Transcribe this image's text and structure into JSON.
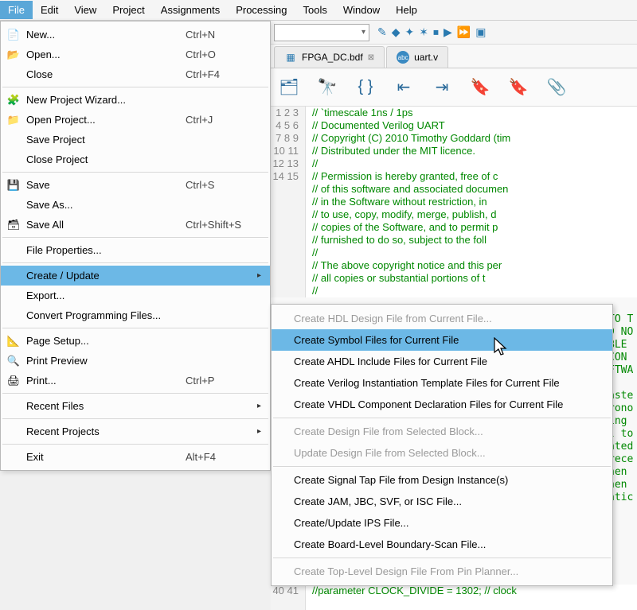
{
  "menubar": [
    "File",
    "Edit",
    "View",
    "Project",
    "Assignments",
    "Processing",
    "Tools",
    "Window",
    "Help"
  ],
  "active_menu": 0,
  "file_menu": {
    "items": [
      {
        "icon": "📄",
        "label": "New...",
        "shortcut": "Ctrl+N",
        "sub": false
      },
      {
        "icon": "📂",
        "label": "Open...",
        "shortcut": "Ctrl+O",
        "sub": false
      },
      {
        "icon": "",
        "label": "Close",
        "shortcut": "Ctrl+F4",
        "sub": false
      },
      {
        "sep": true
      },
      {
        "icon": "🧩",
        "label": "New Project Wizard...",
        "shortcut": "",
        "sub": false
      },
      {
        "icon": "📁",
        "label": "Open Project...",
        "shortcut": "Ctrl+J",
        "sub": false
      },
      {
        "icon": "",
        "label": "Save Project",
        "shortcut": "",
        "sub": false
      },
      {
        "icon": "",
        "label": "Close Project",
        "shortcut": "",
        "sub": false
      },
      {
        "sep": true
      },
      {
        "icon": "💾",
        "label": "Save",
        "shortcut": "Ctrl+S",
        "sub": false
      },
      {
        "icon": "",
        "label": "Save As...",
        "shortcut": "",
        "sub": false
      },
      {
        "icon": "🗃",
        "label": "Save All",
        "shortcut": "Ctrl+Shift+S",
        "sub": false
      },
      {
        "sep": true
      },
      {
        "icon": "",
        "label": "File Properties...",
        "shortcut": "",
        "sub": false
      },
      {
        "sep": true
      },
      {
        "icon": "",
        "label": "Create / Update",
        "shortcut": "",
        "sub": true,
        "hl": true
      },
      {
        "icon": "",
        "label": "Export...",
        "shortcut": "",
        "sub": false
      },
      {
        "icon": "",
        "label": "Convert Programming Files...",
        "shortcut": "",
        "sub": false
      },
      {
        "sep": true
      },
      {
        "icon": "📐",
        "label": "Page Setup...",
        "shortcut": "",
        "sub": false
      },
      {
        "icon": "🔍",
        "label": "Print Preview",
        "shortcut": "",
        "sub": false
      },
      {
        "icon": "🖨",
        "label": "Print...",
        "shortcut": "Ctrl+P",
        "sub": false
      },
      {
        "sep": true
      },
      {
        "icon": "",
        "label": "Recent Files",
        "shortcut": "",
        "sub": true
      },
      {
        "sep": true
      },
      {
        "icon": "",
        "label": "Recent Projects",
        "shortcut": "",
        "sub": true
      },
      {
        "sep": true
      },
      {
        "icon": "",
        "label": "Exit",
        "shortcut": "Alt+F4",
        "sub": false
      }
    ]
  },
  "submenu": {
    "items": [
      {
        "label": "Create HDL Design File from Current File...",
        "enabled": false
      },
      {
        "label": "Create Symbol Files for Current File",
        "enabled": true,
        "hl": true
      },
      {
        "label": "Create AHDL Include Files for Current File",
        "enabled": true
      },
      {
        "label": "Create Verilog Instantiation Template Files for Current File",
        "enabled": true
      },
      {
        "label": "Create VHDL Component Declaration Files for Current File",
        "enabled": true
      },
      {
        "sep": true
      },
      {
        "label": "Create Design File from Selected Block...",
        "enabled": false
      },
      {
        "label": "Update Design File from Selected Block...",
        "enabled": false
      },
      {
        "sep": true
      },
      {
        "label": "Create Signal Tap File from Design Instance(s)",
        "enabled": true
      },
      {
        "label": "Create JAM, JBC, SVF, or ISC File...",
        "enabled": true
      },
      {
        "label": "Create/Update IPS File...",
        "enabled": true
      },
      {
        "label": "Create Board-Level Boundary-Scan File...",
        "enabled": true
      },
      {
        "sep": true
      },
      {
        "label": "Create Top-Level Design File From Pin Planner...",
        "enabled": false
      }
    ]
  },
  "tabs": [
    {
      "icon": "🔷",
      "name": "FPGA_DC.bdf"
    },
    {
      "icon": "abc",
      "name": "uart.v"
    }
  ],
  "code": {
    "lines": [
      "// `timescale 1ns / 1ps",
      "// Documented Verilog UART",
      "// Copyright (C) 2010 Timothy Goddard (tim",
      "// Distributed under the MIT licence.",
      "//",
      "// Permission is hereby granted, free of c",
      "// of this software and associated documen",
      "// in the Software without restriction, in",
      "// to use, copy, modify, merge, publish, d",
      "// copies of the Software, and to permit p",
      "// furnished to do so, subject to the foll",
      "//",
      "// The above copyright notice and this per",
      "// all copies or substantial portions of t",
      "//"
    ],
    "start_line": 1,
    "frag_right": [
      "TO T",
      "D NO",
      "BLE",
      "CON",
      "FTWA",
      "",
      "aste",
      "rono",
      "ing",
      "l to",
      "ated",
      "rece",
      "hen",
      "hen",
      "atic"
    ],
    "bottom": [
      {
        "n": "40",
        "t": "//parameter CLOCK_DIVIDE = 1302; // clock"
      },
      {
        "n": "41",
        "t": ""
      }
    ]
  }
}
